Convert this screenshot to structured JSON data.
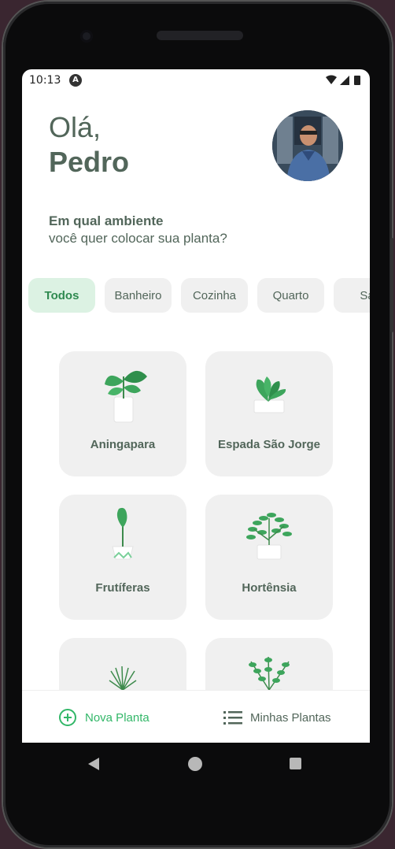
{
  "status_bar": {
    "time": "10:13",
    "app_icon_glyph": "A",
    "icons": [
      "wifi-icon",
      "signal-icon",
      "battery-icon"
    ]
  },
  "header": {
    "greeting": "Olá,",
    "user_name": "Pedro"
  },
  "prompt": {
    "line1": "Em qual ambiente",
    "line2": "você quer colocar sua planta?"
  },
  "environments": [
    {
      "label": "Todos",
      "active": true
    },
    {
      "label": "Banheiro",
      "active": false
    },
    {
      "label": "Cozinha",
      "active": false
    },
    {
      "label": "Quarto",
      "active": false
    },
    {
      "label": "Sa",
      "active": false
    }
  ],
  "plants": [
    {
      "name": "Aningapara",
      "icon": "plant-pot-icon"
    },
    {
      "name": "Espada São Jorge",
      "icon": "plant-pot-icon"
    },
    {
      "name": "Frutíferas",
      "icon": "plant-pot-icon"
    },
    {
      "name": "Hortênsia",
      "icon": "plant-pot-icon"
    },
    {
      "name": "",
      "icon": "plant-pot-icon"
    },
    {
      "name": "",
      "icon": "plant-pot-icon"
    }
  ],
  "bottom_tabs": {
    "new_plant": "Nova Planta",
    "my_plants": "Minhas Plantas"
  },
  "colors": {
    "accent_green": "#32b768",
    "text_heading": "#52665a",
    "chip_active_bg": "#dcf2e3",
    "card_bg": "#f0f0f0"
  }
}
